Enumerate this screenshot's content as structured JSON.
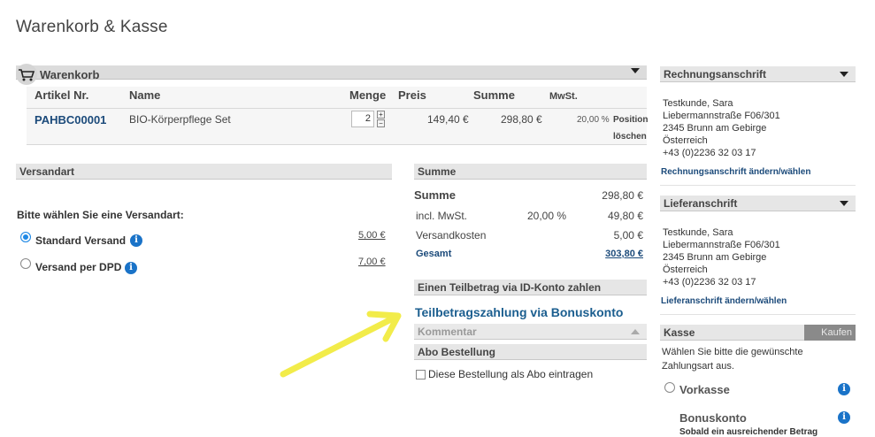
{
  "page": {
    "title": "Warenkorb & Kasse"
  },
  "cart": {
    "title": "Warenkorb",
    "headers": {
      "article_no": "Artikel Nr.",
      "name": "Name",
      "quantity": "Menge",
      "price": "Preis",
      "sum": "Summe",
      "vat": "MwSt."
    },
    "items": [
      {
        "article_no": "PAHBC00001",
        "name": "BIO-Körperpflege Set",
        "quantity": "2",
        "price": "149,40 €",
        "sum": "298,80 €",
        "vat": "20,00 %",
        "action_1": "Position",
        "action_2": "löschen"
      }
    ]
  },
  "shipping": {
    "title": "Versandart",
    "prompt": "Bitte wählen Sie eine Versandart:",
    "options": [
      {
        "label": "Standard Versand",
        "price": "5,00 €",
        "selected": true
      },
      {
        "label": "Versand per DPD",
        "price": "7,00 €",
        "selected": false
      }
    ]
  },
  "summary": {
    "title": "Summe",
    "total_label": "Summe",
    "total_value": "298,80 €",
    "vat_label": "incl. MwSt.",
    "vat_rate": "20,00 %",
    "vat_value": "49,80 €",
    "shipping_label": "Versandkosten",
    "shipping_value": "5,00 €",
    "grand_label": "Gesamt",
    "grand_value": "303,80 €"
  },
  "partial_payment": {
    "title": "Einen Teilbetrag via ID-Konto zahlen",
    "link": "Teilbetragszahlung via Bonuskonto"
  },
  "comment": {
    "title": "Kommentar"
  },
  "subscription": {
    "title": "Abo Bestellung",
    "checkbox_label": "Diese Bestellung als Abo eintragen"
  },
  "billing": {
    "title": "Rechnungsanschrift",
    "lines": [
      "Testkunde,  Sara",
      "Liebermannstraße F06/301",
      "2345  Brunn am Gebirge",
      "Österreich",
      "+43 (0)2236 32 03 17"
    ],
    "link": "Rechnungsanschrift ändern/wählen"
  },
  "delivery": {
    "title": "Lieferanschrift",
    "lines": [
      "Testkunde,  Sara",
      "Liebermannstraße F06/301",
      "2345  Brunn am Gebirge",
      "Österreich",
      "+43 (0)2236 32 03 17"
    ],
    "link": "Lieferanschrift ändern/wählen"
  },
  "checkout": {
    "title": "Kasse",
    "button": "Kaufen",
    "text": "Wählen Sie bitte die gewünschte Zahlungsart aus.",
    "methods": [
      {
        "label": "Vorkasse"
      },
      {
        "label": "Bonuskonto",
        "note": "Sobald ein ausreichender Betrag"
      }
    ]
  },
  "colors": {
    "link": "#1b4a7a",
    "accent": "#1e88e5",
    "arrow": "#f2ec4a"
  }
}
